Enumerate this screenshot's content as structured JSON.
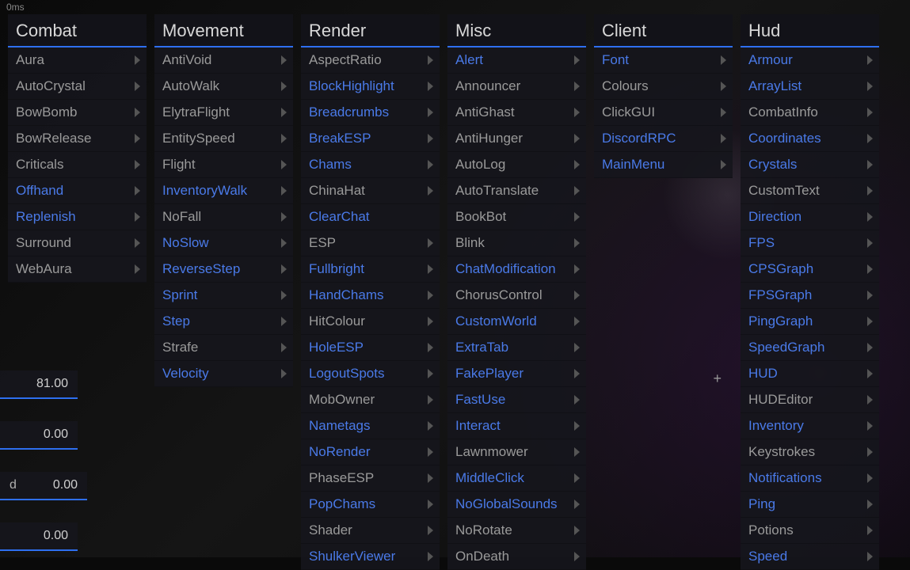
{
  "ms_indicator": "0ms",
  "side_values": [
    "81.00",
    "0.00",
    "0.00",
    "0.00"
  ],
  "side_labels": [
    "",
    "",
    "d",
    ""
  ],
  "panels": [
    {
      "title": "Combat",
      "items": [
        {
          "label": "Aura",
          "enabled": false,
          "arrow": true
        },
        {
          "label": "AutoCrystal",
          "enabled": false,
          "arrow": true
        },
        {
          "label": "BowBomb",
          "enabled": false,
          "arrow": true
        },
        {
          "label": "BowRelease",
          "enabled": false,
          "arrow": true
        },
        {
          "label": "Criticals",
          "enabled": false,
          "arrow": true
        },
        {
          "label": "Offhand",
          "enabled": true,
          "arrow": true
        },
        {
          "label": "Replenish",
          "enabled": true,
          "arrow": true
        },
        {
          "label": "Surround",
          "enabled": false,
          "arrow": true
        },
        {
          "label": "WebAura",
          "enabled": false,
          "arrow": true
        }
      ]
    },
    {
      "title": "Movement",
      "items": [
        {
          "label": "AntiVoid",
          "enabled": false,
          "arrow": true
        },
        {
          "label": "AutoWalk",
          "enabled": false,
          "arrow": true
        },
        {
          "label": "ElytraFlight",
          "enabled": false,
          "arrow": true
        },
        {
          "label": "EntitySpeed",
          "enabled": false,
          "arrow": true
        },
        {
          "label": "Flight",
          "enabled": false,
          "arrow": true
        },
        {
          "label": "InventoryWalk",
          "enabled": true,
          "arrow": true
        },
        {
          "label": "NoFall",
          "enabled": false,
          "arrow": true
        },
        {
          "label": "NoSlow",
          "enabled": true,
          "arrow": true
        },
        {
          "label": "ReverseStep",
          "enabled": true,
          "arrow": true
        },
        {
          "label": "Sprint",
          "enabled": true,
          "arrow": true
        },
        {
          "label": "Step",
          "enabled": true,
          "arrow": true
        },
        {
          "label": "Strafe",
          "enabled": false,
          "arrow": true
        },
        {
          "label": "Velocity",
          "enabled": true,
          "arrow": true
        }
      ]
    },
    {
      "title": "Render",
      "items": [
        {
          "label": "AspectRatio",
          "enabled": false,
          "arrow": true
        },
        {
          "label": "BlockHighlight",
          "enabled": true,
          "arrow": true
        },
        {
          "label": "Breadcrumbs",
          "enabled": true,
          "arrow": true
        },
        {
          "label": "BreakESP",
          "enabled": true,
          "arrow": true
        },
        {
          "label": "Chams",
          "enabled": true,
          "arrow": true
        },
        {
          "label": "ChinaHat",
          "enabled": false,
          "arrow": true
        },
        {
          "label": "ClearChat",
          "enabled": true,
          "arrow": false
        },
        {
          "label": "ESP",
          "enabled": false,
          "arrow": true
        },
        {
          "label": "Fullbright",
          "enabled": true,
          "arrow": true
        },
        {
          "label": "HandChams",
          "enabled": true,
          "arrow": true
        },
        {
          "label": "HitColour",
          "enabled": false,
          "arrow": true
        },
        {
          "label": "HoleESP",
          "enabled": true,
          "arrow": true
        },
        {
          "label": "LogoutSpots",
          "enabled": true,
          "arrow": true
        },
        {
          "label": "MobOwner",
          "enabled": false,
          "arrow": true
        },
        {
          "label": "Nametags",
          "enabled": true,
          "arrow": true
        },
        {
          "label": "NoRender",
          "enabled": true,
          "arrow": true
        },
        {
          "label": "PhaseESP",
          "enabled": false,
          "arrow": true
        },
        {
          "label": "PopChams",
          "enabled": true,
          "arrow": true
        },
        {
          "label": "Shader",
          "enabled": false,
          "arrow": true
        },
        {
          "label": "ShulkerViewer",
          "enabled": true,
          "arrow": true
        }
      ]
    },
    {
      "title": "Misc",
      "items": [
        {
          "label": "Alert",
          "enabled": true,
          "arrow": true
        },
        {
          "label": "Announcer",
          "enabled": false,
          "arrow": true
        },
        {
          "label": "AntiGhast",
          "enabled": false,
          "arrow": true
        },
        {
          "label": "AntiHunger",
          "enabled": false,
          "arrow": true
        },
        {
          "label": "AutoLog",
          "enabled": false,
          "arrow": true
        },
        {
          "label": "AutoTranslate",
          "enabled": false,
          "arrow": true
        },
        {
          "label": "BookBot",
          "enabled": false,
          "arrow": true
        },
        {
          "label": "Blink",
          "enabled": false,
          "arrow": true
        },
        {
          "label": "ChatModification",
          "enabled": true,
          "arrow": true
        },
        {
          "label": "ChorusControl",
          "enabled": false,
          "arrow": true
        },
        {
          "label": "CustomWorld",
          "enabled": true,
          "arrow": true
        },
        {
          "label": "ExtraTab",
          "enabled": true,
          "arrow": true
        },
        {
          "label": "FakePlayer",
          "enabled": true,
          "arrow": true
        },
        {
          "label": "FastUse",
          "enabled": true,
          "arrow": true
        },
        {
          "label": "Interact",
          "enabled": true,
          "arrow": true
        },
        {
          "label": "Lawnmower",
          "enabled": false,
          "arrow": true
        },
        {
          "label": "MiddleClick",
          "enabled": true,
          "arrow": true
        },
        {
          "label": "NoGlobalSounds",
          "enabled": true,
          "arrow": true
        },
        {
          "label": "NoRotate",
          "enabled": false,
          "arrow": true
        },
        {
          "label": "OnDeath",
          "enabled": false,
          "arrow": true
        }
      ]
    },
    {
      "title": "Client",
      "items": [
        {
          "label": "Font",
          "enabled": true,
          "arrow": true
        },
        {
          "label": "Colours",
          "enabled": false,
          "arrow": true
        },
        {
          "label": "ClickGUI",
          "enabled": false,
          "arrow": true
        },
        {
          "label": "DiscordRPC",
          "enabled": true,
          "arrow": true
        },
        {
          "label": "MainMenu",
          "enabled": true,
          "arrow": true
        }
      ]
    },
    {
      "title": "Hud",
      "items": [
        {
          "label": "Armour",
          "enabled": true,
          "arrow": true
        },
        {
          "label": "ArrayList",
          "enabled": true,
          "arrow": true
        },
        {
          "label": "CombatInfo",
          "enabled": false,
          "arrow": true
        },
        {
          "label": "Coordinates",
          "enabled": true,
          "arrow": true
        },
        {
          "label": "Crystals",
          "enabled": true,
          "arrow": true
        },
        {
          "label": "CustomText",
          "enabled": false,
          "arrow": true
        },
        {
          "label": "Direction",
          "enabled": true,
          "arrow": true
        },
        {
          "label": "FPS",
          "enabled": true,
          "arrow": true
        },
        {
          "label": "CPSGraph",
          "enabled": true,
          "arrow": true
        },
        {
          "label": "FPSGraph",
          "enabled": true,
          "arrow": true
        },
        {
          "label": "PingGraph",
          "enabled": true,
          "arrow": true
        },
        {
          "label": "SpeedGraph",
          "enabled": true,
          "arrow": true
        },
        {
          "label": "HUD",
          "enabled": true,
          "arrow": true
        },
        {
          "label": "HUDEditor",
          "enabled": false,
          "arrow": true
        },
        {
          "label": "Inventory",
          "enabled": true,
          "arrow": true
        },
        {
          "label": "Keystrokes",
          "enabled": false,
          "arrow": true
        },
        {
          "label": "Notifications",
          "enabled": true,
          "arrow": true
        },
        {
          "label": "Ping",
          "enabled": true,
          "arrow": true
        },
        {
          "label": "Potions",
          "enabled": false,
          "arrow": true
        },
        {
          "label": "Speed",
          "enabled": true,
          "arrow": true
        }
      ]
    }
  ]
}
